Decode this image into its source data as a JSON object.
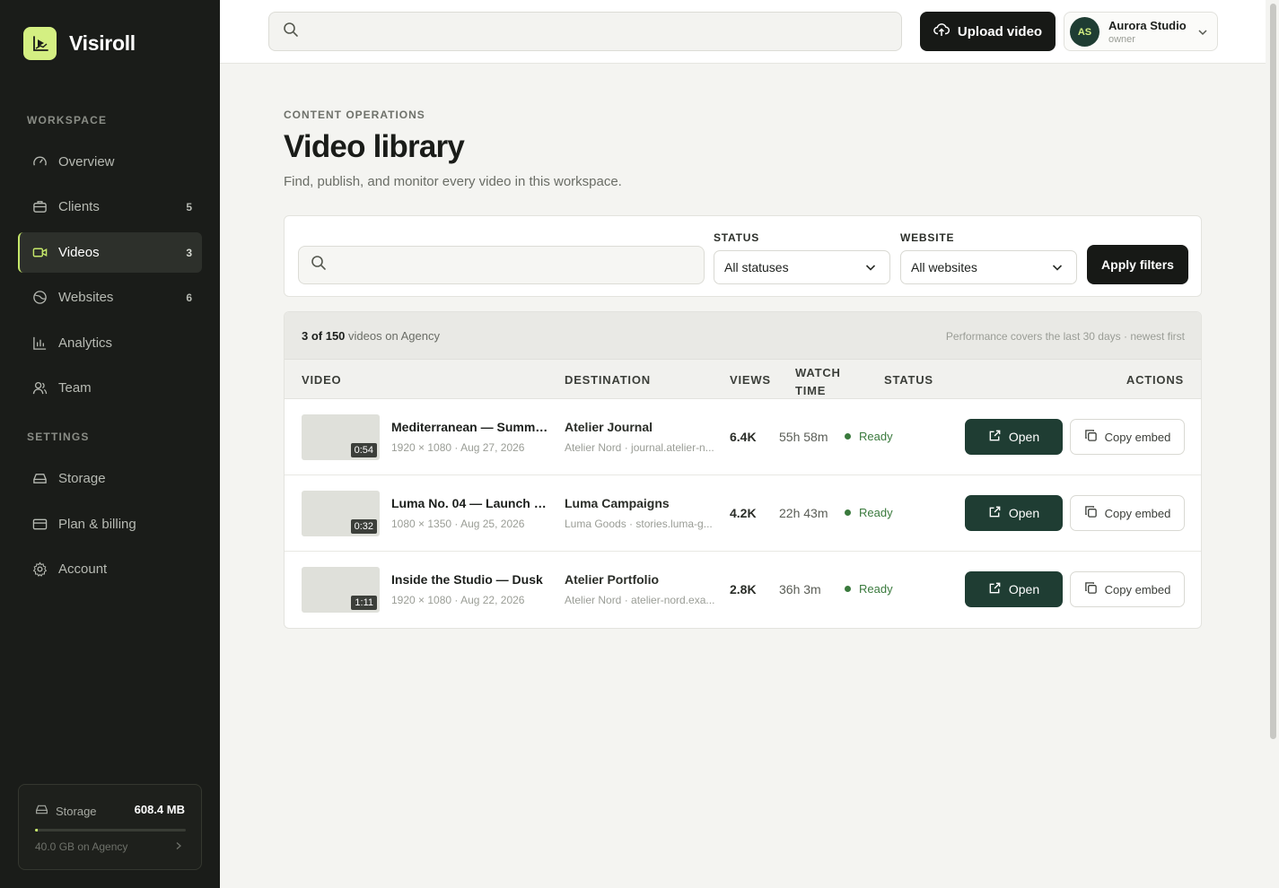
{
  "brand": {
    "name": "Visiroll",
    "logo_icon": "play-chart-icon",
    "accent": "#d4ef82"
  },
  "sidebar": {
    "workspace_label": "WORKSPACE",
    "settings_label": "SETTINGS",
    "workspace_items": [
      {
        "label": "Overview",
        "icon": "gauge-icon",
        "count": ""
      },
      {
        "label": "Clients",
        "icon": "briefcase-icon",
        "count": "5"
      },
      {
        "label": "Videos",
        "icon": "video-camera-icon",
        "count": "3",
        "active": true
      },
      {
        "label": "Websites",
        "icon": "globe-icon",
        "count": "6"
      },
      {
        "label": "Analytics",
        "icon": "bar-chart-icon",
        "count": ""
      },
      {
        "label": "Team",
        "icon": "users-icon",
        "count": ""
      }
    ],
    "settings_items": [
      {
        "label": "Storage",
        "icon": "drive-icon"
      },
      {
        "label": "Plan & billing",
        "icon": "credit-card-icon"
      },
      {
        "label": "Account",
        "icon": "gear-icon"
      }
    ],
    "storage": {
      "label": "Storage",
      "value": "608.4 MB",
      "sub": "40.0 GB on Agency",
      "used_fraction": 0.015
    }
  },
  "topbar": {
    "search_placeholder": "",
    "upload_label": "Upload video",
    "account": {
      "initials": "AS",
      "name": "Aurora Studio",
      "role": "owner"
    }
  },
  "page": {
    "eyebrow": "CONTENT OPERATIONS",
    "title": "Video library",
    "subtitle": "Find, publish, and monitor every video in this workspace."
  },
  "filters": {
    "search_placeholder": "",
    "status_label": "STATUS",
    "status_value": "All statuses",
    "website_label": "WEBSITE",
    "website_value": "All websites",
    "apply_label": "Apply filters"
  },
  "table": {
    "summary_count": "3 of 150",
    "summary_rest": "videos on Agency",
    "summary_note": "Performance covers the last 30 days · newest first",
    "headers": {
      "video": "VIDEO",
      "destination": "DESTINATION",
      "views": "VIEWS",
      "watch_1": "WATCH",
      "watch_2": "TIME",
      "status": "STATUS",
      "actions": "ACTIONS"
    },
    "rows": [
      {
        "duration": "0:54",
        "title": "Mediterranean — Summe...",
        "meta": "1920 × 1080 · Aug 27, 2026",
        "dest_name": "Atelier Journal",
        "dest_sub": "Atelier Nord · journal.atelier-n...",
        "views": "6.4K",
        "watch": "55h 58m",
        "status": "Ready",
        "open": "Open",
        "copy": "Copy embed"
      },
      {
        "duration": "0:32",
        "title": "Luma No. 04 — Launch St...",
        "meta": "1080 × 1350 · Aug 25, 2026",
        "dest_name": "Luma Campaigns",
        "dest_sub": "Luma Goods · stories.luma-g...",
        "views": "4.2K",
        "watch": "22h 43m",
        "status": "Ready",
        "open": "Open",
        "copy": "Copy embed"
      },
      {
        "duration": "1:11",
        "title": "Inside the Studio — Dusk",
        "meta": "1920 × 1080 · Aug 22, 2026",
        "dest_name": "Atelier Portfolio",
        "dest_sub": "Atelier Nord · atelier-nord.exa...",
        "views": "2.8K",
        "watch": "36h 3m",
        "status": "Ready",
        "open": "Open",
        "copy": "Copy embed"
      }
    ]
  }
}
